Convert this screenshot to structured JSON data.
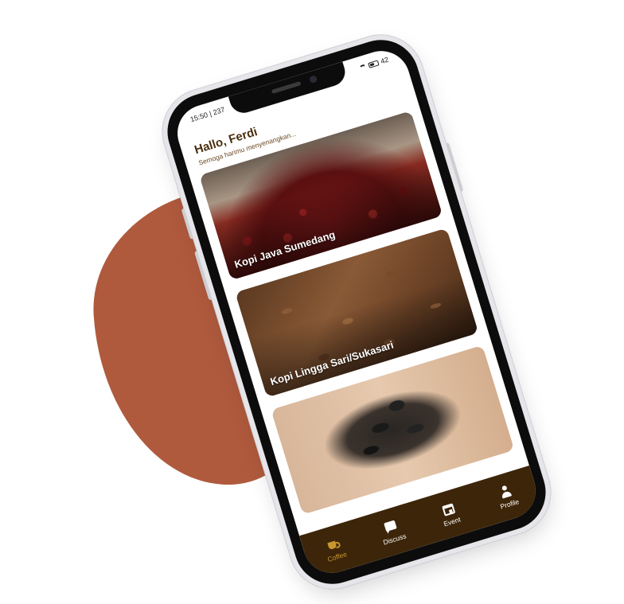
{
  "status_bar": {
    "time": "15:50 | 237",
    "battery": "42"
  },
  "greeting": {
    "title": "Hallo, Ferdi",
    "subtitle": "Semoga harimu menyenangkan..."
  },
  "coffee_list": [
    {
      "title": "Kopi Java Sumedang"
    },
    {
      "title": "Kopi Lingga Sari/Sukasari"
    },
    {
      "title": ""
    }
  ],
  "bottom_nav": [
    {
      "label": "Coffee",
      "icon": "coffee-cup-icon",
      "active": true
    },
    {
      "label": "Discuss",
      "icon": "chat-icon",
      "active": false
    },
    {
      "label": "Event",
      "icon": "calendar-icon",
      "active": false
    },
    {
      "label": "Profile",
      "icon": "person-icon",
      "active": false
    }
  ],
  "colors": {
    "accent_brown": "#3d2509",
    "active_gold": "#c8962e",
    "blob": "#b05a3d"
  }
}
